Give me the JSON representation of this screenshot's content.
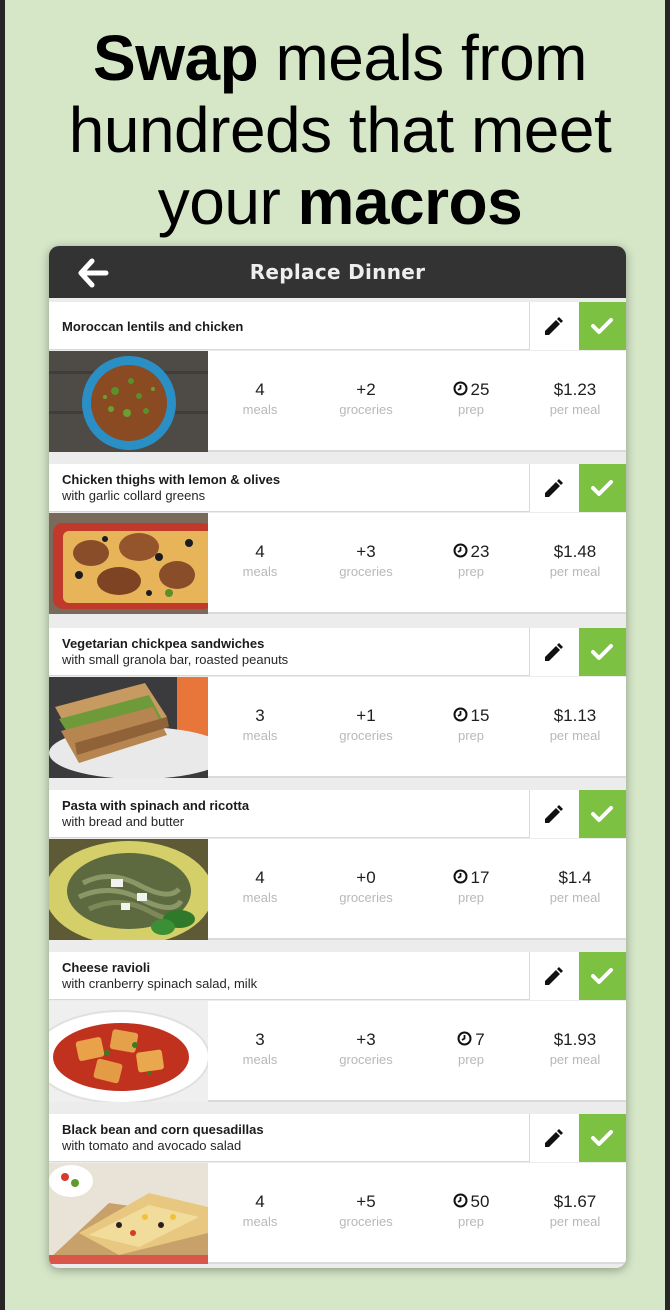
{
  "headline": {
    "bold_start": "Swap",
    "middle": " meals from hundreds that meet your ",
    "bold_end": "macros"
  },
  "topbar": {
    "title": "Replace Dinner",
    "back_icon": "back-arrow-icon"
  },
  "colors": {
    "background": "#d6e7c8",
    "topbar": "#333333",
    "accent": "#7cc142"
  },
  "meals": [
    {
      "title": "Moroccan lentils and chicken",
      "subtitle": "",
      "meals": "4",
      "meals_label": "meals",
      "groceries": "+2",
      "groceries_label": "groceries",
      "prep": "25",
      "prep_label": "prep",
      "price": "$1.23",
      "price_label": "per meal"
    },
    {
      "title": "Chicken thighs with lemon & olives",
      "subtitle": "with garlic collard greens",
      "meals": "4",
      "meals_label": "meals",
      "groceries": "+3",
      "groceries_label": "groceries",
      "prep": "23",
      "prep_label": "prep",
      "price": "$1.48",
      "price_label": "per meal"
    },
    {
      "title": "Vegetarian chickpea sandwiches",
      "subtitle": "with small granola bar, roasted peanuts",
      "meals": "3",
      "meals_label": "meals",
      "groceries": "+1",
      "groceries_label": "groceries",
      "prep": "15",
      "prep_label": "prep",
      "price": "$1.13",
      "price_label": "per meal"
    },
    {
      "title": "Pasta with spinach and ricotta",
      "subtitle": "with bread and butter",
      "meals": "4",
      "meals_label": "meals",
      "groceries": "+0",
      "groceries_label": "groceries",
      "prep": "17",
      "prep_label": "prep",
      "price": "$1.4",
      "price_label": "per meal"
    },
    {
      "title": "Cheese ravioli",
      "subtitle": "with cranberry spinach salad, milk",
      "meals": "3",
      "meals_label": "meals",
      "groceries": "+3",
      "groceries_label": "groceries",
      "prep": "7",
      "prep_label": "prep",
      "price": "$1.93",
      "price_label": "per meal"
    },
    {
      "title": "Black bean and corn quesadillas",
      "subtitle": "with tomato and avocado salad",
      "meals": "4",
      "meals_label": "meals",
      "groceries": "+5",
      "groceries_label": "groceries",
      "prep": "50",
      "prep_label": "prep",
      "price": "$1.67",
      "price_label": "per meal"
    }
  ]
}
